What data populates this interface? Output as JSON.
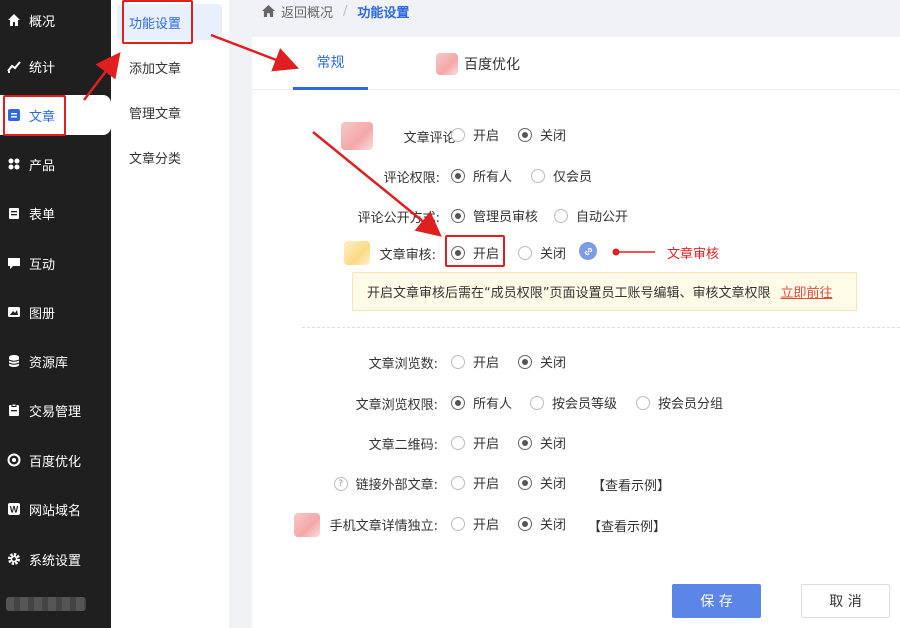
{
  "sidebar": {
    "items": [
      {
        "label": "概况",
        "icon": "home-icon"
      },
      {
        "label": "统计",
        "icon": "stats-icon"
      },
      {
        "label": "文章",
        "icon": "article-icon",
        "active": true
      },
      {
        "label": "产品",
        "icon": "product-icon"
      },
      {
        "label": "表单",
        "icon": "form-icon"
      },
      {
        "label": "互动",
        "icon": "chat-icon"
      },
      {
        "label": "图册",
        "icon": "album-icon"
      },
      {
        "label": "资源库",
        "icon": "database-icon"
      },
      {
        "label": "交易管理",
        "icon": "trade-icon"
      },
      {
        "label": "百度优化",
        "icon": "seo-icon"
      },
      {
        "label": "网站域名",
        "icon": "domain-icon"
      },
      {
        "label": "系统设置",
        "icon": "gear-icon"
      }
    ]
  },
  "subnav": {
    "items": [
      {
        "label": "功能设置",
        "active": true
      },
      {
        "label": "添加文章"
      },
      {
        "label": "管理文章"
      },
      {
        "label": "文章分类"
      }
    ]
  },
  "breadcrumb": {
    "back": "返回概况",
    "sep": "/",
    "current": "功能设置"
  },
  "tabs": [
    {
      "label": "常规",
      "active": true
    },
    {
      "label": "百度优化"
    }
  ],
  "settings": {
    "comment": {
      "label": "文章评论:",
      "options": [
        "开启",
        "关闭"
      ],
      "selected": "关闭"
    },
    "comment_permission": {
      "label": "评论权限:",
      "options": [
        "所有人",
        "仅会员"
      ],
      "selected": "所有人"
    },
    "comment_publish": {
      "label": "评论公开方式:",
      "options": [
        "管理员审核",
        "自动公开"
      ],
      "selected": "管理员审核"
    },
    "review": {
      "label": "文章审核:",
      "options": [
        "开启",
        "关闭"
      ],
      "selected": "开启"
    },
    "views": {
      "label": "文章浏览数:",
      "options": [
        "开启",
        "关闭"
      ],
      "selected": "关闭"
    },
    "view_permission": {
      "label": "文章浏览权限:",
      "options": [
        "所有人",
        "按会员等级",
        "按会员分组"
      ],
      "selected": "所有人"
    },
    "qrcode": {
      "label": "文章二维码:",
      "options": [
        "开启",
        "关闭"
      ],
      "selected": "关闭"
    },
    "external_link": {
      "label": "链接外部文章:",
      "options": [
        "开启",
        "关闭"
      ],
      "selected": "关闭",
      "example": "【查看示例】"
    },
    "mobile_detail": {
      "label": "手机文章详情独立:",
      "options": [
        "开启",
        "关闭"
      ],
      "selected": "关闭",
      "example": "【查看示例】"
    }
  },
  "notice": {
    "text": "开启文章审核后需在“成员权限”页面设置员工账号编辑、审核文章权限",
    "link": "立即前往"
  },
  "annotation": {
    "text": "文章审核"
  },
  "buttons": {
    "save": "保 存",
    "cancel": "取 消"
  },
  "colors": {
    "accent": "#2d6ae0",
    "sidebar_bg": "#1f1f1f",
    "annotation_red": "#e02020",
    "save_btn": "#5b85e6"
  }
}
